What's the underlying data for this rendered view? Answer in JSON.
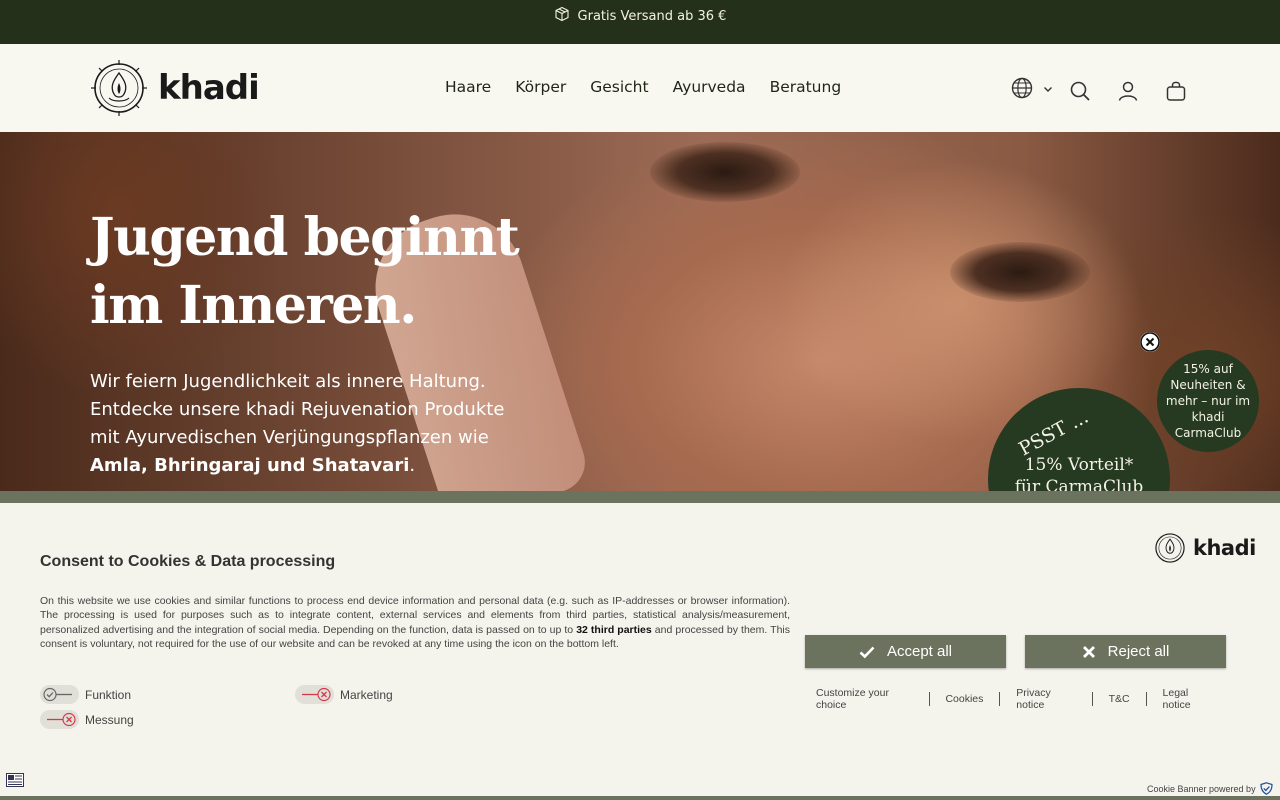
{
  "topbar": {
    "icon": "box-icon",
    "text": "Gratis Versand ab 36 €"
  },
  "header": {
    "logo_text": "khadi",
    "nav": [
      "Haare",
      "Körper",
      "Gesicht",
      "Ayurveda",
      "Beratung"
    ],
    "icons": [
      "globe-icon",
      "chevron-down-icon",
      "search-icon",
      "account-icon",
      "cart-icon"
    ]
  },
  "hero": {
    "title_line1": "Jugend beginnt",
    "title_line2": "im Inneren.",
    "text_plain": "Wir feiern Jugendlichkeit als innere Haltung. Entdecke unsere khadi Rejuvenation Produkte mit Ayurvedischen Verjüngungspflanzen wie ",
    "text_bold": "Amla, Bhringaraj und Shatavari",
    "text_end": "."
  },
  "promo": {
    "psst": "PSST ...",
    "offer_line1": "15% Vorteil*",
    "offer_line2": "für CarmaClub",
    "badge": "15% auf Neuheiten & mehr – nur im khadi CarmaClub"
  },
  "cookie": {
    "title": "Consent to Cookies & Data processing",
    "body_start": "On this website we use cookies and similar functions to process end device information and personal data (e.g. such as IP-addresses or browser information). The processing is used for purposes such as to integrate content, external services and elements from third parties, statistical analysis/measurement, personalized advertising and the integration of social media. Depending on the function, data is passed on to up to ",
    "body_bold": "32 third parties",
    "body_end": " and processed by them. This consent is voluntary, not required for the use of our website and can be revoked at any time using the icon on the bottom left.",
    "toggles": [
      {
        "label": "Funktion",
        "state": "on"
      },
      {
        "label": "Marketing",
        "state": "off"
      },
      {
        "label": "Messung",
        "state": "off"
      }
    ],
    "logo_text": "khadi",
    "accept_label": "Accept all",
    "reject_label": "Reject all",
    "links": [
      "Customize your choice",
      "Cookies",
      "Privacy notice",
      "T&C",
      "Legal notice"
    ],
    "powered_by": "Cookie Banner powered by"
  },
  "colors": {
    "topbar_bg": "#24301a",
    "header_bg": "#f8f7f0",
    "cookie_bg": "#f4f3ec",
    "button_bg": "#6b735e",
    "promo_bg": "#253a21",
    "toggle_off": "#d6394a"
  }
}
